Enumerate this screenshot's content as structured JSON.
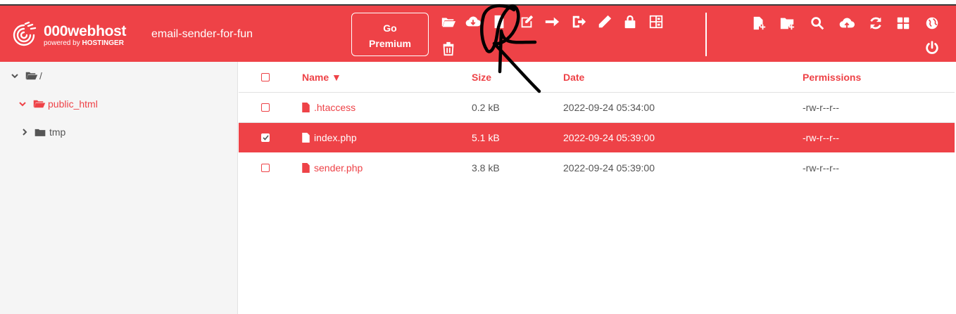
{
  "header": {
    "brand_name": "000webhost",
    "brand_sub_prefix": "powered by ",
    "brand_sub_company": "HOSTINGER",
    "site_name": "email-sender-for-fun",
    "go_premium_line1": "Go",
    "go_premium_line2": "Premium",
    "toolbar_icons": [
      "folder-open-icon",
      "cloud-download-icon",
      "file-icon",
      "edit-icon",
      "arrow-right-icon",
      "sign-out-icon",
      "pencil-icon",
      "lock-icon",
      "archive-icon",
      "trash-icon"
    ],
    "right_icons": [
      "new-file-icon",
      "new-folder-icon",
      "search-icon",
      "cloud-upload-icon",
      "refresh-icon",
      "grid-icon",
      "globe-icon",
      "power-icon"
    ]
  },
  "colors": {
    "accent": "#ee4247",
    "text": "#555555",
    "tree_bg": "#f5f5f5"
  },
  "tree": [
    {
      "label": "/",
      "expanded": true,
      "active": false
    },
    {
      "label": "public_html",
      "expanded": true,
      "active": true
    },
    {
      "label": "tmp",
      "expanded": false,
      "active": false
    }
  ],
  "table": {
    "columns": {
      "name": "Name ▼",
      "size": "Size",
      "date": "Date",
      "permissions": "Permissions"
    },
    "rows": [
      {
        "name": ".htaccess",
        "size": "0.2 kB",
        "date": "2022-09-24 05:34:00",
        "permissions": "-rw-r--r--",
        "selected": false
      },
      {
        "name": "index.php",
        "size": "5.1 kB",
        "date": "2022-09-24 05:39:00",
        "permissions": "-rw-r--r--",
        "selected": true
      },
      {
        "name": "sender.php",
        "size": "3.8 kB",
        "date": "2022-09-24 05:39:00",
        "permissions": "-rw-r--r--",
        "selected": false
      }
    ]
  }
}
